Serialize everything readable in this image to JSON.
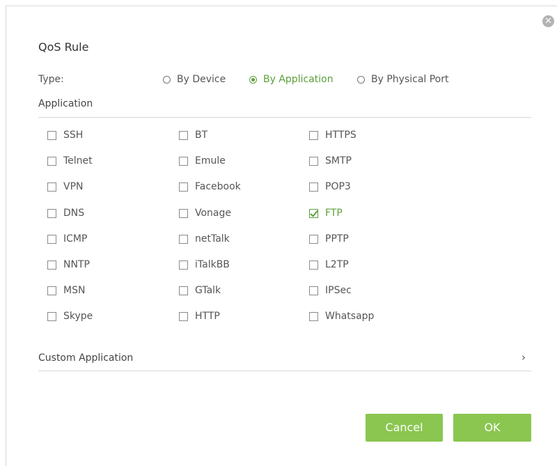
{
  "dialog": {
    "title": "QoS Rule",
    "close_icon": "close-icon"
  },
  "type": {
    "label": "Type:",
    "options": [
      {
        "label": "By Device",
        "checked": false
      },
      {
        "label": "By Application",
        "checked": true
      },
      {
        "label": "By Physical Port",
        "checked": false
      }
    ]
  },
  "application": {
    "label": "Application",
    "columns": [
      [
        {
          "label": "SSH",
          "checked": false
        },
        {
          "label": "Telnet",
          "checked": false
        },
        {
          "label": "VPN",
          "checked": false
        },
        {
          "label": "DNS",
          "checked": false
        },
        {
          "label": "ICMP",
          "checked": false
        },
        {
          "label": "NNTP",
          "checked": false
        },
        {
          "label": "MSN",
          "checked": false
        },
        {
          "label": "Skype",
          "checked": false
        }
      ],
      [
        {
          "label": "BT",
          "checked": false
        },
        {
          "label": "Emule",
          "checked": false
        },
        {
          "label": "Facebook",
          "checked": false
        },
        {
          "label": "Vonage",
          "checked": false
        },
        {
          "label": "netTalk",
          "checked": false
        },
        {
          "label": "iTalkBB",
          "checked": false
        },
        {
          "label": "GTalk",
          "checked": false
        },
        {
          "label": "HTTP",
          "checked": false
        }
      ],
      [
        {
          "label": "HTTPS",
          "checked": false
        },
        {
          "label": "SMTP",
          "checked": false
        },
        {
          "label": "POP3",
          "checked": false
        },
        {
          "label": "FTP",
          "checked": true
        },
        {
          "label": "PPTP",
          "checked": false
        },
        {
          "label": "L2TP",
          "checked": false
        },
        {
          "label": "IPSec",
          "checked": false
        },
        {
          "label": "Whatsapp",
          "checked": false
        }
      ]
    ]
  },
  "custom_application": {
    "label": "Custom Application",
    "chevron": "›"
  },
  "buttons": {
    "cancel": "Cancel",
    "ok": "OK"
  },
  "colors": {
    "accent": "#5ba03b",
    "button": "#8ac650"
  }
}
